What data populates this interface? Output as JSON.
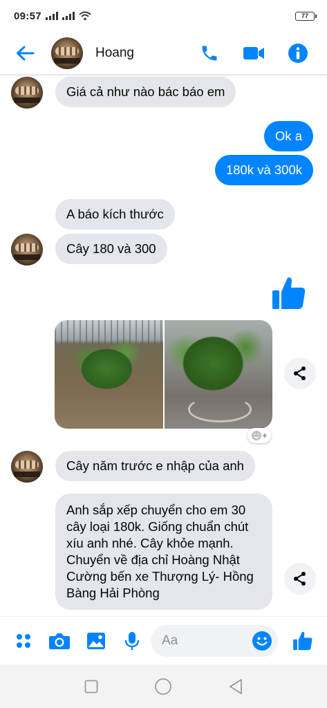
{
  "status_bar": {
    "time": "09:57",
    "battery": "77",
    "icons": [
      "signal-icon",
      "signal-icon",
      "wifi-icon",
      "battery-icon"
    ]
  },
  "header": {
    "contact_name": "Hoang",
    "icons": [
      "back-arrow-icon",
      "phone-icon",
      "video-camera-icon",
      "info-icon"
    ],
    "accent_color": "#0084ff"
  },
  "messages": [
    {
      "side": "in",
      "text": "Giá cả như nào bác báo em"
    },
    {
      "side": "out",
      "text": "Ok a"
    },
    {
      "side": "out",
      "text": "180k và 300k"
    },
    {
      "side": "in",
      "text": "A báo kích thước"
    },
    {
      "side": "in",
      "text": "Cây 180 và 300"
    },
    {
      "side": "out",
      "type": "like-sticker"
    },
    {
      "side": "in",
      "type": "photos",
      "count": 2
    },
    {
      "side": "in",
      "text": "Cây năm trước e nhập của anh"
    },
    {
      "side": "in",
      "text": "Anh sắp xếp chuyển cho em 30 cây loại 180k. Giống chuẩn chút xíu anh nhé. Cây khỏe mạnh. Chuyển về địa chỉ Hoàng Nhật Cường bến xe Thượng Lý- Hồng Bàng Hải Phòng"
    }
  ],
  "composer": {
    "placeholder": "Aa",
    "value": "",
    "icons": [
      "menu-dots-icon",
      "camera-icon",
      "image-icon",
      "microphone-icon",
      "emoji-icon",
      "like-icon"
    ]
  },
  "nav_bar": {
    "icons": [
      "recent-apps-icon",
      "home-icon",
      "back-icon"
    ]
  },
  "colors": {
    "outgoing_bubble": "#0084ff",
    "incoming_bubble": "#e4e6eb"
  }
}
